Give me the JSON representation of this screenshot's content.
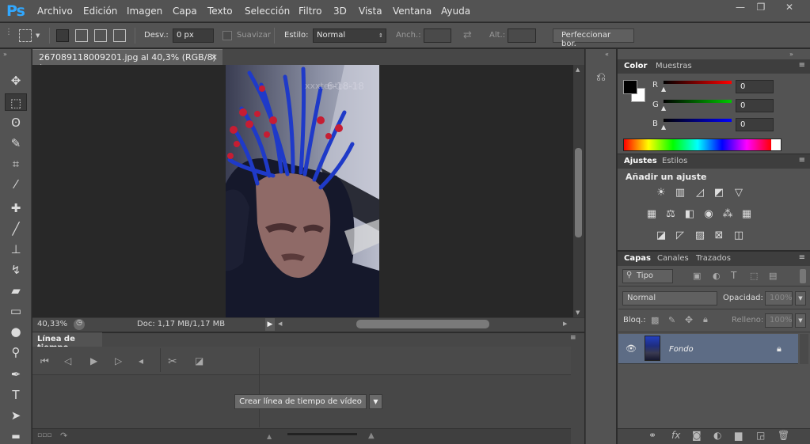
{
  "app": {
    "logo": "Ps"
  },
  "menu": [
    "Archivo",
    "Edición",
    "Imagen",
    "Capa",
    "Texto",
    "Selección",
    "Filtro",
    "3D",
    "Vista",
    "Ventana",
    "Ayuda"
  ],
  "window_controls": [
    "—",
    "❐",
    "✕"
  ],
  "options": {
    "desvanecer_label": "Desv.:",
    "desvanecer_value": "0 px",
    "suavizar_label": "Suavizar",
    "estilo_label": "Estilo:",
    "estilo_value": "Normal",
    "anch_label": "Anch.:",
    "alt_label": "Alt.:",
    "refine_button": "Perfeccionar bor."
  },
  "document": {
    "tab_title": "267089118009201.jpg al 40,3% (RGB/8) *",
    "zoom": "40,33%",
    "doc_info": "Doc: 1,17 MB/1,17 MB",
    "watermark_top": "xxxtentacion",
    "watermark_date": "6-18-18"
  },
  "timeline": {
    "tab": "Línea de tiempo",
    "create_button": "Crear línea de tiempo de vídeo"
  },
  "color_panel": {
    "tabs": [
      "Color",
      "Muestras"
    ],
    "channels": [
      {
        "label": "R",
        "value": "0",
        "color": "#ff0000"
      },
      {
        "label": "G",
        "value": "0",
        "color": "#00c800"
      },
      {
        "label": "B",
        "value": "0",
        "color": "#0000ff"
      }
    ],
    "foreground": "#000000",
    "background": "#ffffff"
  },
  "adjustments_panel": {
    "tabs": [
      "Ajustes",
      "Estilos"
    ],
    "heading": "Añadir un ajuste"
  },
  "layers_panel": {
    "tabs": [
      "Capas",
      "Canales",
      "Trazados"
    ],
    "filter": "Tipo",
    "blend_mode": "Normal",
    "opacity_label": "Opacidad:",
    "opacity_value": "100%",
    "lock_label": "Bloq.:",
    "fill_label": "Relleno:",
    "fill_value": "100%",
    "layers": [
      {
        "name": "Fondo"
      }
    ]
  }
}
